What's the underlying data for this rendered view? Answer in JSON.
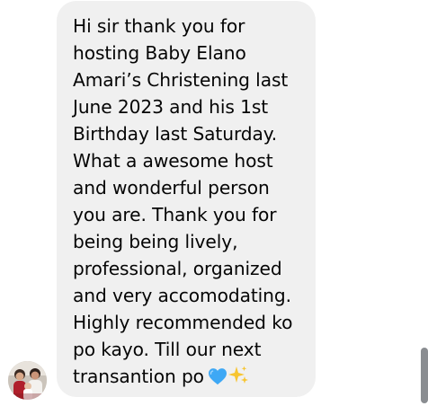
{
  "message": {
    "text": "Hi sir thank you for\nhosting Baby Elano\nAmari’s Christening last\nJune 2023 and his 1st\nBirthday last Saturday.\nWhat a awesome host\nand wonderful person\nyou are. Thank you for\nbeing being lively,\nprofessional, organized\nand very accomodating.\nHighly recommended ko\npo kayo. Till our next\ntransantion po",
    "trailing_emojis": [
      "blue-heart-icon",
      "sparkles-icon"
    ]
  },
  "sender": {
    "avatar_icon": "profile-photo"
  },
  "colors": {
    "bubble_background": "#f0f0f0",
    "text": "#050505",
    "heart": "#3ea8f5",
    "sparkles": "#f7c531",
    "scrollbar_thumb": "#8a8d91"
  }
}
